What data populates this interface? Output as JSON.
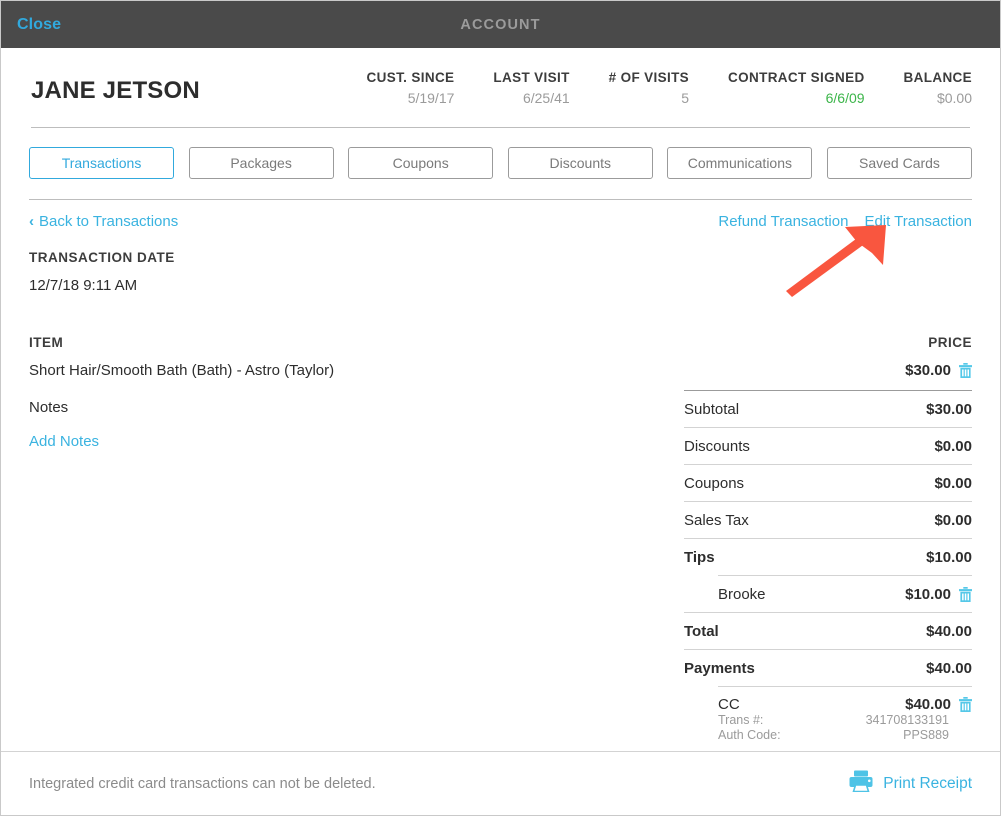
{
  "topbar": {
    "close_label": "Close",
    "title": "ACCOUNT",
    "bg_color": "#4a4a4a",
    "link_color": "#31a9dd"
  },
  "customer": {
    "name": "JANE JETSON",
    "stats": [
      {
        "label": "CUST. SINCE",
        "value": "5/19/17",
        "color": "#9b9b9b"
      },
      {
        "label": "LAST VISIT",
        "value": "6/25/41",
        "color": "#9b9b9b"
      },
      {
        "label": "# OF VISITS",
        "value": "5",
        "color": "#9b9b9b"
      },
      {
        "label": "CONTRACT SIGNED",
        "value": "6/6/09",
        "color": "#3cb54a"
      },
      {
        "label": "BALANCE",
        "value": "$0.00",
        "color": "#9b9b9b"
      }
    ]
  },
  "tabs": [
    {
      "label": "Transactions",
      "active": true
    },
    {
      "label": "Packages",
      "active": false
    },
    {
      "label": "Coupons",
      "active": false
    },
    {
      "label": "Discounts",
      "active": false
    },
    {
      "label": "Communications",
      "active": false
    },
    {
      "label": "Saved Cards",
      "active": false
    }
  ],
  "actions": {
    "back_label": "Back to Transactions",
    "back_chevron": "‹",
    "refund_label": "Refund Transaction",
    "edit_label": "Edit Transaction"
  },
  "transaction": {
    "date_label": "TRANSACTION DATE",
    "date_value": "12/7/18 9:11 AM",
    "item_header": "ITEM",
    "price_header": "PRICE",
    "item_name": "Short Hair/Smooth Bath (Bath) - Astro (Taylor)",
    "item_price": "$30.00",
    "notes_label": "Notes",
    "add_notes_label": "Add Notes"
  },
  "totals": {
    "subtotal": {
      "label": "Subtotal",
      "value": "$30.00"
    },
    "discounts": {
      "label": "Discounts",
      "value": "$0.00"
    },
    "coupons": {
      "label": "Coupons",
      "value": "$0.00"
    },
    "sales_tax": {
      "label": "Sales Tax",
      "value": "$0.00"
    },
    "tips": {
      "label": "Tips",
      "value": "$10.00"
    },
    "tip_entry": {
      "label": "Brooke",
      "value": "$10.00"
    },
    "total": {
      "label": "Total",
      "value": "$40.00"
    },
    "payments": {
      "label": "Payments",
      "value": "$40.00"
    },
    "payment_entry": {
      "label": "CC",
      "value": "$40.00",
      "trans_label": "Trans #:",
      "trans_value": "341708133191",
      "auth_label": "Auth Code:",
      "auth_value": "PPS889"
    }
  },
  "footer": {
    "note": "Integrated credit card transactions can not be deleted.",
    "print_label": "Print Receipt"
  },
  "annotation": {
    "arrow_color": "#f9563f",
    "points_at": "Edit Transaction"
  }
}
